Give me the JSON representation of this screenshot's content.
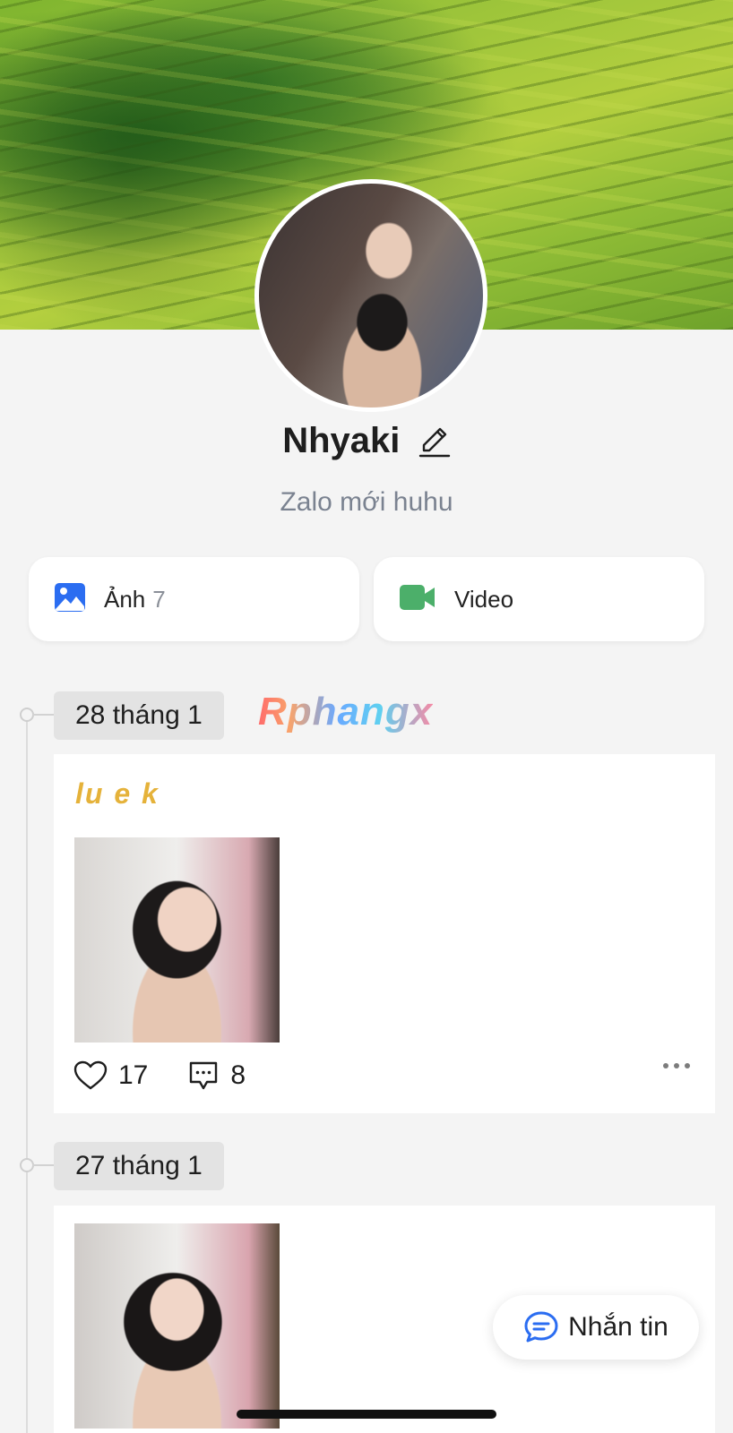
{
  "profile": {
    "name": "Nhyaki",
    "status": "Zalo mới huhu"
  },
  "media": {
    "photos_label": "Ảnh",
    "photos_count": "7",
    "videos_label": "Video"
  },
  "watermark": "Rphangx",
  "timeline": [
    {
      "date": "28 tháng 1",
      "title": "lu e k",
      "likes": "17",
      "comments": "8"
    },
    {
      "date": "27 tháng 1"
    }
  ],
  "fab": {
    "label": "Nhắn tin"
  },
  "colors": {
    "accent_blue": "#2b6df1",
    "video_green": "#4caf6a",
    "post_title": "#e5b23a"
  },
  "icons": {
    "photos": "image-icon",
    "videos": "video-camera-icon",
    "edit": "pencil-icon",
    "like": "heart-icon",
    "comment": "comment-icon",
    "more": "more-dots-icon",
    "message": "chat-bubble-icon"
  }
}
